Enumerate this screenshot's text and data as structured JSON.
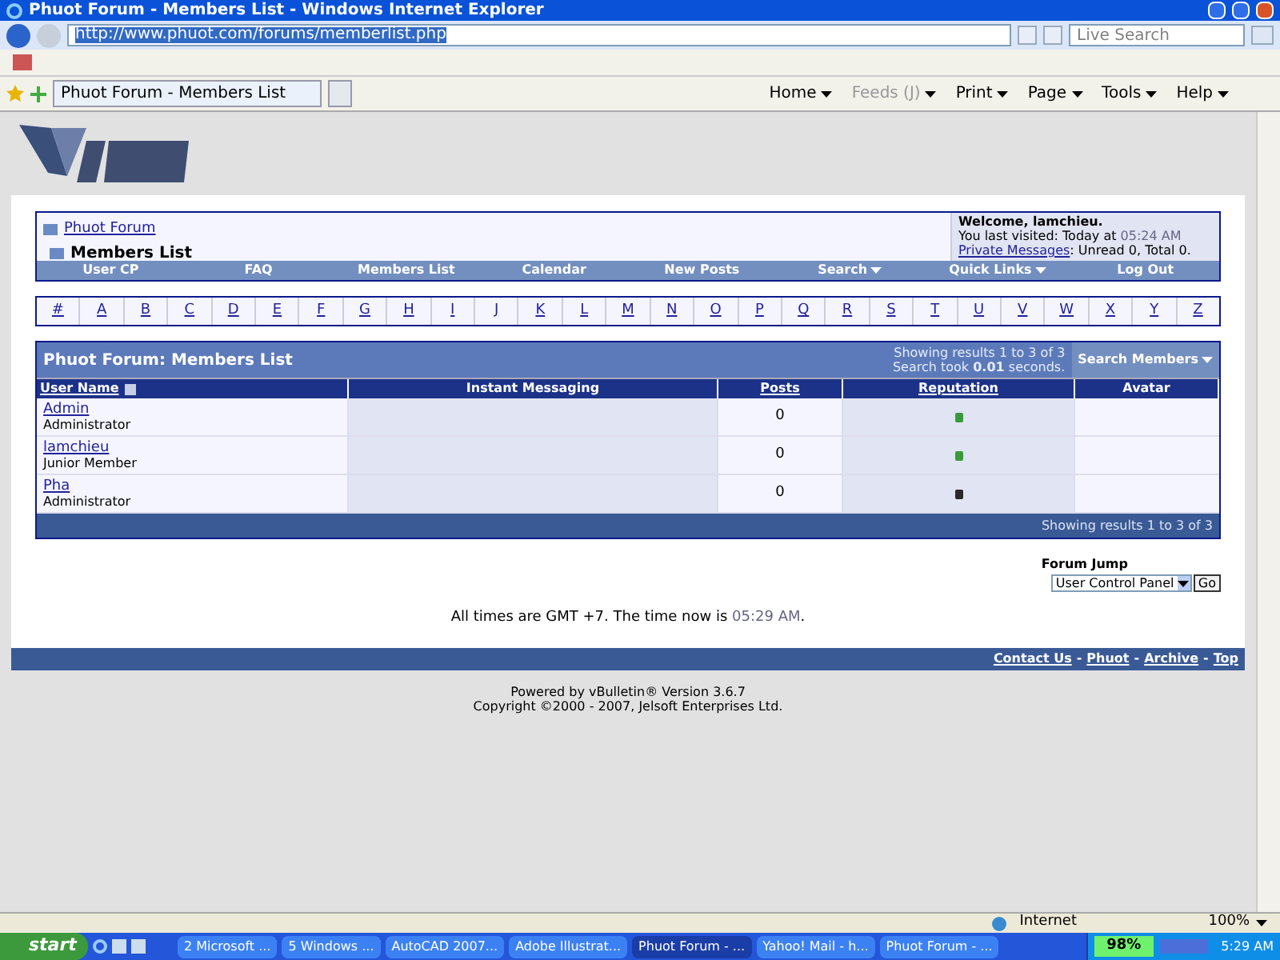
{
  "window": {
    "title": "Phuot Forum - Members List - Windows Internet Explorer"
  },
  "address_bar": {
    "url": "http://www.phuot.com/forums/memberlist.php"
  },
  "search": {
    "placeholder": "Live Search"
  },
  "tab": {
    "title": "Phuot Forum - Members List"
  },
  "command_bar": [
    {
      "label": "Home",
      "disabled": false
    },
    {
      "label": "Feeds (J)",
      "disabled": true
    },
    {
      "label": "Print",
      "disabled": false
    },
    {
      "label": "Page",
      "disabled": false
    },
    {
      "label": "Tools",
      "disabled": false
    },
    {
      "label": "Help",
      "disabled": false
    }
  ],
  "breadcrumb": {
    "parent": "Phuot Forum",
    "current": "Members List"
  },
  "welcome": {
    "greeting": "Welcome, lamchieu.",
    "last_visit": "You last visited: Today at",
    "last_time": "05:24 AM",
    "pm_link": "Private Messages",
    "pm_counts": ": Unread 0, Total 0."
  },
  "navbar": [
    {
      "label": "User CP",
      "menu": false
    },
    {
      "label": "FAQ",
      "menu": false
    },
    {
      "label": "Members List",
      "menu": false
    },
    {
      "label": "Calendar",
      "menu": false
    },
    {
      "label": "New Posts",
      "menu": false
    },
    {
      "label": "Search",
      "menu": true
    },
    {
      "label": "Quick Links",
      "menu": true
    },
    {
      "label": "Log Out",
      "menu": false
    }
  ],
  "letters": [
    "#",
    "A",
    "B",
    "C",
    "D",
    "E",
    "F",
    "G",
    "H",
    "I",
    "J",
    "K",
    "L",
    "M",
    "N",
    "O",
    "P",
    "Q",
    "R",
    "S",
    "T",
    "U",
    "V",
    "W",
    "X",
    "Y",
    "Z"
  ],
  "members": {
    "title": "Phuot Forum: Members List",
    "results": "Showing results 1 to 3 of 3",
    "search_took": "Search took **0.01** seconds.",
    "search_button": "Search Members",
    "columns": [
      {
        "label": "User Name",
        "link": true
      },
      {
        "label": "Instant Messaging",
        "link": false
      },
      {
        "label": "Posts",
        "link": true
      },
      {
        "label": "Reputation",
        "link": true
      },
      {
        "label": "Avatar",
        "link": false
      }
    ],
    "rows": [
      {
        "name": "Admin",
        "rank": "Administrator",
        "posts": "0",
        "color": "#3a9a3a"
      },
      {
        "name": "lamchieu",
        "rank": "Junior Member",
        "posts": "0",
        "color": "#3a9a3a"
      },
      {
        "name": "Pha",
        "rank": "Administrator",
        "posts": "0",
        "color": "#2a2a2a"
      }
    ],
    "footer": "Showing results 1 to 3 of 3"
  },
  "forum_jump": {
    "label": "Forum Jump",
    "value": "User Control Panel",
    "button": "Go"
  },
  "time_note": {
    "text": "All times are GMT +7. The time now is",
    "time": "05:29 AM",
    "end": "."
  },
  "footer_links": [
    "Contact Us",
    "Phuot",
    "Archive",
    "Top"
  ],
  "footer_separator": "-",
  "powered": [
    "Powered by vBulletin® Version 3.6.7",
    "Copyright ©2000 - 2007, Jelsoft Enterprises Ltd."
  ],
  "status_bar": {
    "zone": "Internet",
    "zoom": "100%"
  },
  "taskbar": {
    "start": "start",
    "tasks": [
      {
        "label": "2 Microsoft ...",
        "selected": false
      },
      {
        "label": "5 Windows ...",
        "selected": false
      },
      {
        "label": "AutoCAD 2007...",
        "selected": false
      },
      {
        "label": "Adobe Illustrat...",
        "selected": false
      },
      {
        "label": "Phuot Forum - ...",
        "selected": true
      },
      {
        "label": "Yahoo! Mail - h...",
        "selected": false
      },
      {
        "label": "Phuot Forum - ...",
        "selected": false
      }
    ],
    "battery": "98%",
    "clock": "5:29 AM"
  }
}
